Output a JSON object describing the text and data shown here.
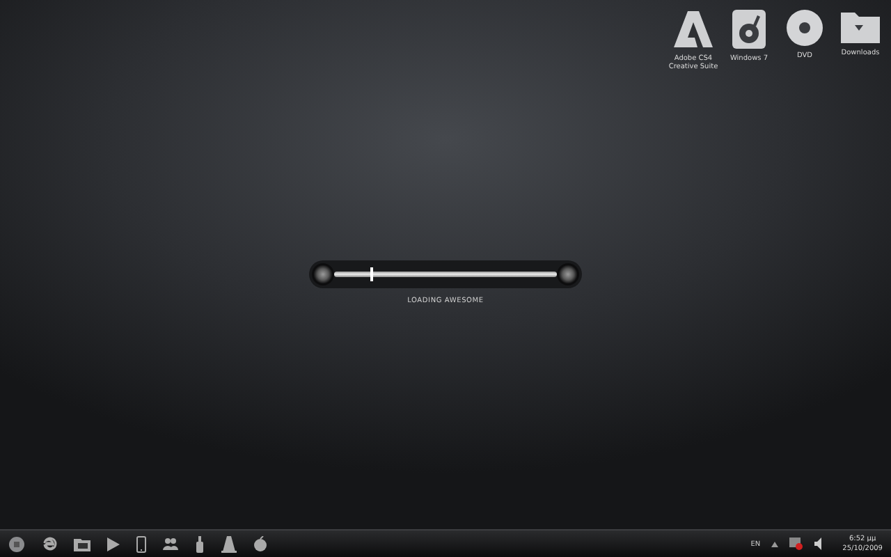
{
  "desktop_icons": [
    {
      "kind": "adobe",
      "label": "Adobe CS4 Creative Suite"
    },
    {
      "kind": "media",
      "label": "Windows 7"
    },
    {
      "kind": "disc",
      "label": "DVD"
    },
    {
      "kind": "folder",
      "label": "Downloads"
    }
  ],
  "loader": {
    "level": 0.16,
    "caption": "LOADING AWESOME"
  },
  "taskbar": {
    "items": [
      {
        "kind": "start"
      },
      {
        "kind": "browser"
      },
      {
        "kind": "explorer"
      },
      {
        "kind": "play"
      },
      {
        "kind": "phone"
      },
      {
        "kind": "people"
      },
      {
        "kind": "brush"
      },
      {
        "kind": "cone"
      },
      {
        "kind": "apple"
      }
    ],
    "language": "EN",
    "time": "6:52 μμ",
    "date": "25/10/2009"
  }
}
